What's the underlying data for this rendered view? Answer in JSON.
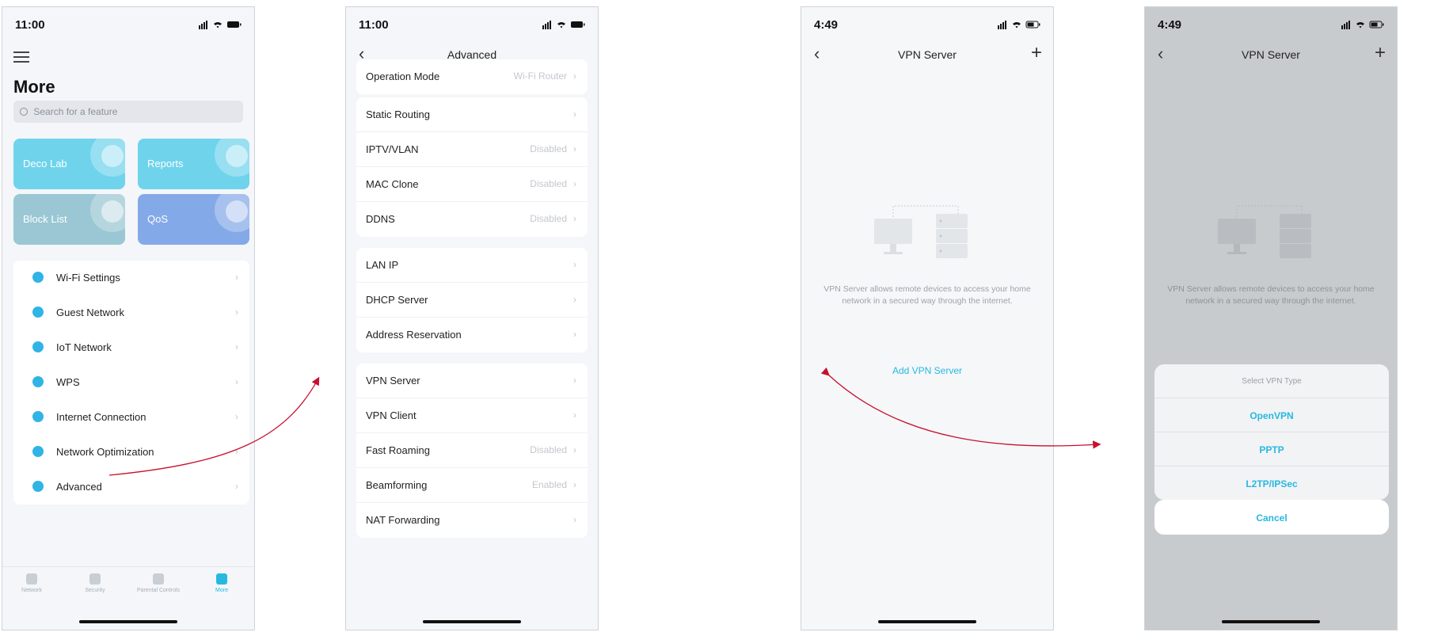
{
  "accent_color": "#27b8e0",
  "arrow_color": "#c8102e",
  "phone1": {
    "time": "11:00",
    "title": "More",
    "search_placeholder": "Search for a feature",
    "tiles": [
      {
        "label": "Deco Lab",
        "color": "#6fd3ec",
        "icon": "lab-icon"
      },
      {
        "label": "Reports",
        "color": "#6fd3ec",
        "icon": "pie-chart-icon"
      },
      {
        "label": "Block List",
        "color": "#9ac7d3",
        "icon": "block-icon"
      },
      {
        "label": "QoS",
        "color": "#84a9e8",
        "icon": "sliders-icon"
      }
    ],
    "menu": [
      {
        "label": "Wi-Fi Settings",
        "icon": "wifi-icon",
        "color": "#2fb4e5"
      },
      {
        "label": "Guest Network",
        "icon": "users-icon",
        "color": "#2fb4e5"
      },
      {
        "label": "IoT Network",
        "icon": "bulb-icon",
        "color": "#2fb4e5"
      },
      {
        "label": "WPS",
        "icon": "shield-icon",
        "color": "#2fb4e5"
      },
      {
        "label": "Internet Connection",
        "icon": "globe-icon",
        "color": "#2fb4e5"
      },
      {
        "label": "Network Optimization",
        "icon": "optimize-icon",
        "color": "#2fb4e5"
      },
      {
        "label": "Advanced",
        "icon": "gear-icon",
        "color": "#2fb4e5"
      }
    ],
    "tabs": [
      {
        "label": "Network",
        "active": false
      },
      {
        "label": "Security",
        "active": false
      },
      {
        "label": "Parental Controls",
        "active": false
      },
      {
        "label": "More",
        "active": true
      }
    ]
  },
  "phone2": {
    "time": "11:00",
    "title": "Advanced",
    "top_row": {
      "label": "Operation Mode",
      "value": "Wi-Fi Router"
    },
    "group1": [
      {
        "label": "Static Routing",
        "value": ""
      },
      {
        "label": "IPTV/VLAN",
        "value": "Disabled"
      },
      {
        "label": "MAC Clone",
        "value": "Disabled"
      },
      {
        "label": "DDNS",
        "value": "Disabled"
      }
    ],
    "group2": [
      {
        "label": "LAN IP",
        "value": ""
      },
      {
        "label": "DHCP Server",
        "value": ""
      },
      {
        "label": "Address Reservation",
        "value": ""
      }
    ],
    "group3": [
      {
        "label": "VPN Server",
        "value": ""
      },
      {
        "label": "VPN Client",
        "value": ""
      },
      {
        "label": "Fast Roaming",
        "value": "Disabled"
      },
      {
        "label": "Beamforming",
        "value": "Enabled"
      },
      {
        "label": "NAT Forwarding",
        "value": ""
      }
    ]
  },
  "phone3": {
    "time": "4:49",
    "title": "VPN Server",
    "description": "VPN Server allows remote devices to access your home network in a secured way through the internet.",
    "add_label": "Add VPN Server"
  },
  "phone4": {
    "time": "4:49",
    "title": "VPN Server",
    "description": "VPN Server allows remote devices to access your home network in a secured way through the internet.",
    "sheet_title": "Select VPN Type",
    "options": [
      "OpenVPN",
      "PPTP",
      "L2TP/IPSec"
    ],
    "cancel": "Cancel"
  }
}
